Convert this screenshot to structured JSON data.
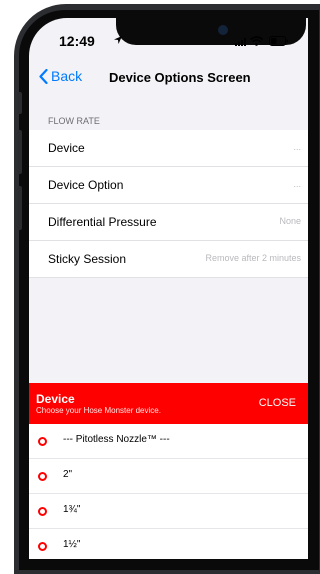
{
  "status_bar": {
    "time": "12:49"
  },
  "nav": {
    "back_label": "Back",
    "title": "Device Options Screen"
  },
  "section": {
    "header": "FLOW RATE"
  },
  "rows": [
    {
      "label": "Device",
      "value": "..."
    },
    {
      "label": "Device Option",
      "value": "..."
    },
    {
      "label": "Differential Pressure",
      "value": "None"
    },
    {
      "label": "Sticky Session",
      "value": "Remove after 2 minutes"
    }
  ],
  "sheet": {
    "title": "Device",
    "subtitle": "Choose your Hose Monster device.",
    "close_label": "CLOSE",
    "accent_color": "#ff0000",
    "options": [
      {
        "label": "--- Pitotless Nozzle™ ---"
      },
      {
        "label": "2\""
      },
      {
        "label": "1¾\""
      },
      {
        "label": "1½\""
      }
    ]
  },
  "icons": {
    "location": "location-arrow-icon",
    "signal": "cellular-signal-icon",
    "wifi": "wifi-icon",
    "battery": "battery-icon",
    "back": "chevron-left-icon",
    "radio": "radio-unselected-icon"
  }
}
